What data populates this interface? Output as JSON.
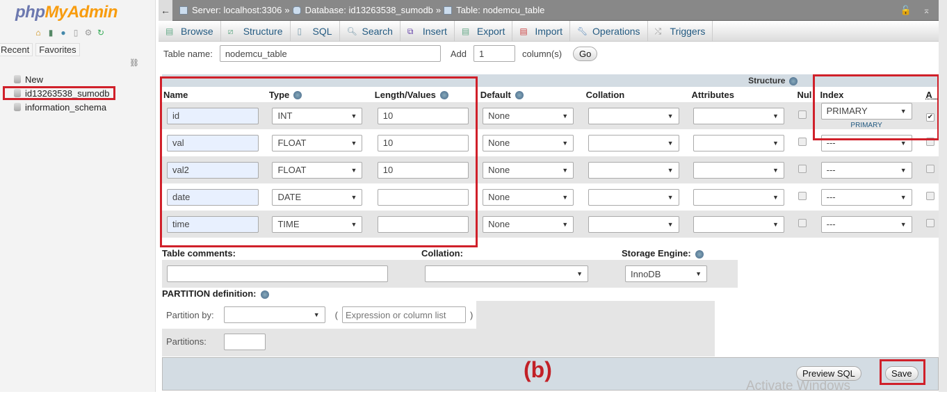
{
  "sidebar": {
    "logo_php": "php",
    "logo_myadmin": "MyAdmin",
    "tabs": [
      "Recent",
      "Favorites"
    ],
    "tree": [
      {
        "label": "New"
      },
      {
        "label": "id13263538_sumodb"
      },
      {
        "label": "information_schema"
      }
    ]
  },
  "breadcrumb": {
    "server": "Server: localhost:3306",
    "database": "Database: id13263538_sumodb",
    "table": "Table: nodemcu_table",
    "sep": "»"
  },
  "menu": [
    "Browse",
    "Structure",
    "SQL",
    "Search",
    "Insert",
    "Export",
    "Import",
    "Operations",
    "Triggers"
  ],
  "table_name": {
    "label": "Table name:",
    "value": "nodemcu_table",
    "add_label": "Add",
    "add_value": "1",
    "columns_label": "column(s)",
    "go": "Go"
  },
  "structure": {
    "title": "Structure",
    "headers": [
      "Name",
      "Type",
      "Length/Values",
      "Default",
      "Collation",
      "Attributes",
      "Null",
      "Index",
      "A_I"
    ],
    "header_display": {
      "null": "Nul",
      "ai": "A_"
    },
    "rows": [
      {
        "name": "id",
        "type": "INT",
        "length": "10",
        "default": "None",
        "collation": "",
        "attributes": "",
        "null": false,
        "index": "PRIMARY",
        "index_note": "PRIMARY",
        "ai": true
      },
      {
        "name": "val",
        "type": "FLOAT",
        "length": "10",
        "default": "None",
        "collation": "",
        "attributes": "",
        "null": false,
        "index": "---",
        "ai": false
      },
      {
        "name": "val2",
        "type": "FLOAT",
        "length": "10",
        "default": "None",
        "collation": "",
        "attributes": "",
        "null": false,
        "index": "---",
        "ai": false
      },
      {
        "name": "date",
        "type": "DATE",
        "length": "",
        "default": "None",
        "collation": "",
        "attributes": "",
        "null": false,
        "index": "---",
        "ai": false
      },
      {
        "name": "time",
        "type": "TIME",
        "length": "",
        "default": "None",
        "collation": "",
        "attributes": "",
        "null": false,
        "index": "---",
        "ai": false
      }
    ]
  },
  "table_options": {
    "comments_label": "Table comments:",
    "comments_value": "",
    "collation_label": "Collation:",
    "collation_value": "",
    "engine_label": "Storage Engine:",
    "engine_value": "InnoDB"
  },
  "partition": {
    "title": "PARTITION definition:",
    "by_label": "Partition by:",
    "by_value": "",
    "expr_placeholder": "Expression or column list",
    "partitions_label": "Partitions:",
    "partitions_value": ""
  },
  "footer": {
    "preview_sql": "Preview SQL",
    "save": "Save",
    "annotation": "(b)",
    "watermark": "Activate Windows"
  },
  "colors": {
    "highlight": "#d0202a",
    "link": "#235a81"
  }
}
